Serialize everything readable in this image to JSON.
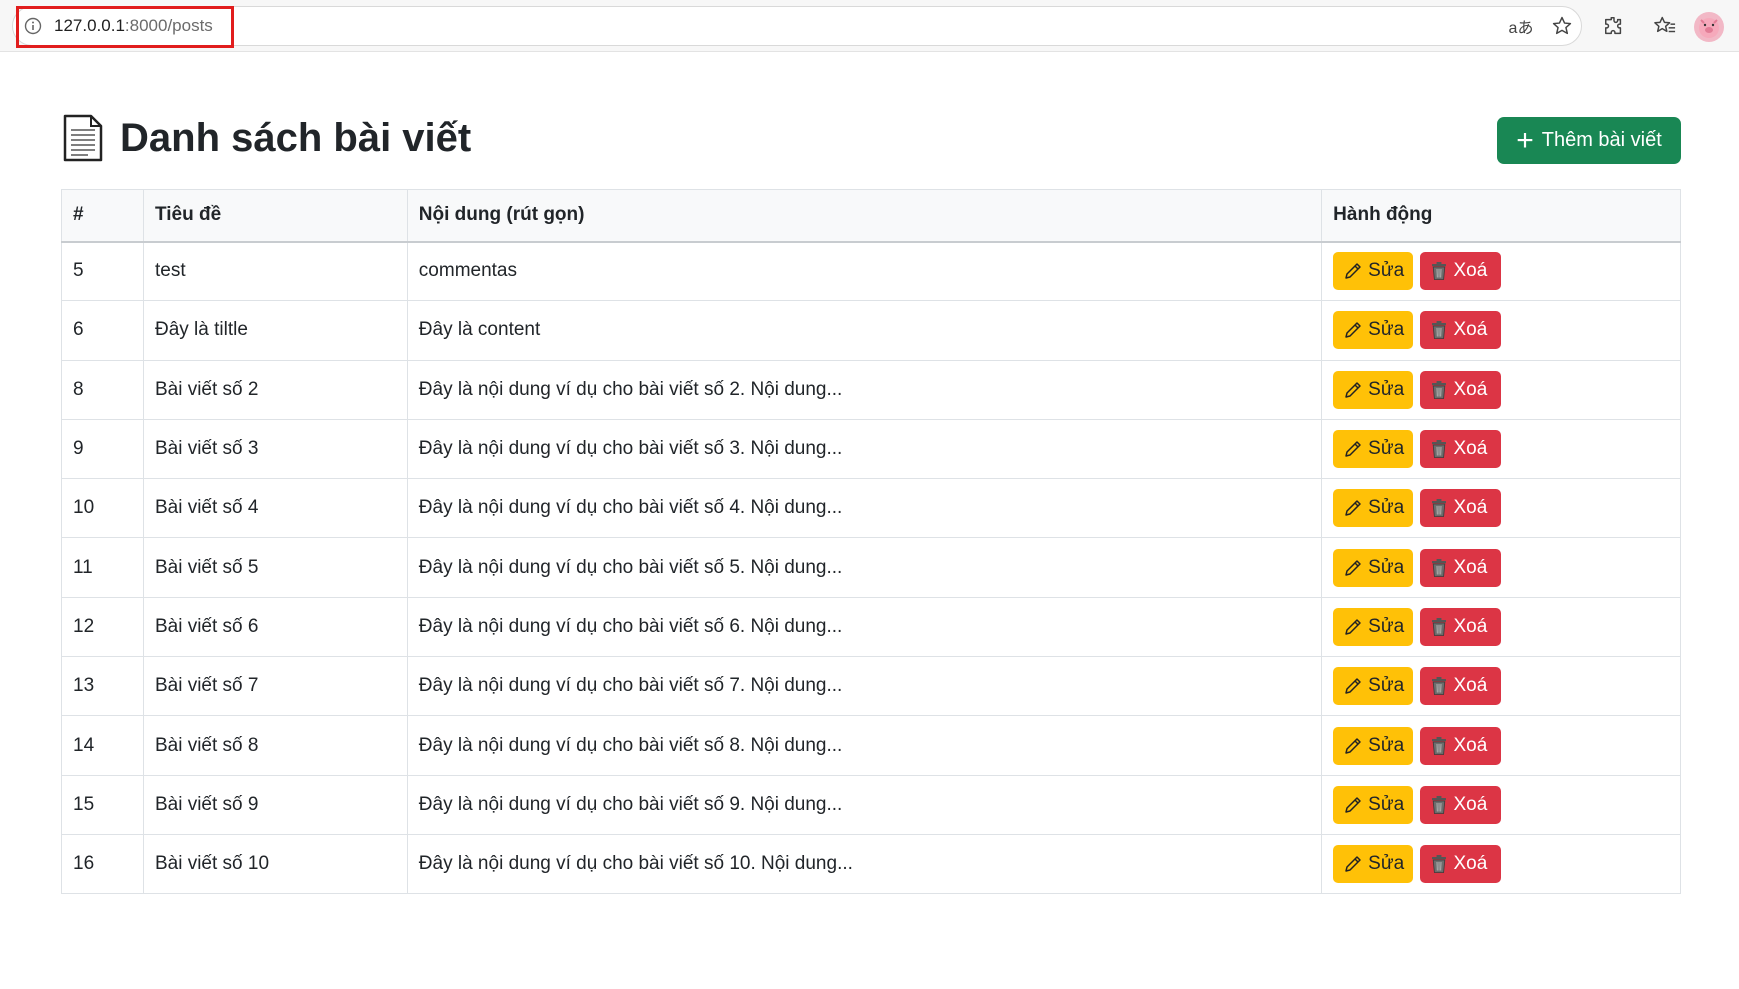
{
  "browser": {
    "url_host": "127.0.0.1",
    "url_rest": ":8000/posts",
    "translate_icon_text": "aあ"
  },
  "page": {
    "title": "Danh sách bài viết",
    "add_button_label": "Thêm bài viết"
  },
  "table": {
    "headers": [
      "#",
      "Tiêu đề",
      "Nội dung (rút gọn)",
      "Hành động"
    ],
    "edit_label": "Sửa",
    "delete_label": "Xoá",
    "rows": [
      {
        "id": "5",
        "title": "test",
        "content": "commentas"
      },
      {
        "id": "6",
        "title": "Đây là tiltle",
        "content": "Đây là content"
      },
      {
        "id": "8",
        "title": "Bài viết số 2",
        "content": "Đây là nội dung ví dụ cho bài viết số 2. Nội dung..."
      },
      {
        "id": "9",
        "title": "Bài viết số 3",
        "content": "Đây là nội dung ví dụ cho bài viết số 3. Nội dung..."
      },
      {
        "id": "10",
        "title": "Bài viết số 4",
        "content": "Đây là nội dung ví dụ cho bài viết số 4. Nội dung..."
      },
      {
        "id": "11",
        "title": "Bài viết số 5",
        "content": "Đây là nội dung ví dụ cho bài viết số 5. Nội dung..."
      },
      {
        "id": "12",
        "title": "Bài viết số 6",
        "content": "Đây là nội dung ví dụ cho bài viết số 6. Nội dung..."
      },
      {
        "id": "13",
        "title": "Bài viết số 7",
        "content": "Đây là nội dung ví dụ cho bài viết số 7. Nội dung..."
      },
      {
        "id": "14",
        "title": "Bài viết số 8",
        "content": "Đây là nội dung ví dụ cho bài viết số 8. Nội dung..."
      },
      {
        "id": "15",
        "title": "Bài viết số 9",
        "content": "Đây là nội dung ví dụ cho bài viết số 9. Nội dung..."
      },
      {
        "id": "16",
        "title": "Bài viết số 10",
        "content": "Đây là nội dung ví dụ cho bài viết số 10. Nội dung..."
      }
    ]
  },
  "colors": {
    "primary_green": "#198754",
    "warning_yellow": "#ffc107",
    "danger_red": "#dc3545",
    "highlight_red": "#e11d1d"
  }
}
